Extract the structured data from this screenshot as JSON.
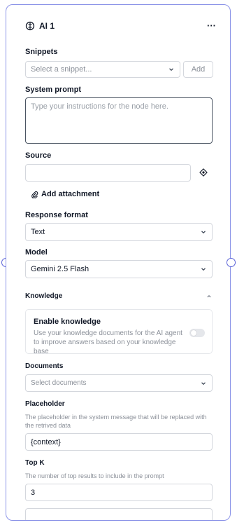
{
  "node": {
    "title": "AI 1",
    "more_label": "···",
    "border_color": "#8b93e8"
  },
  "snippets": {
    "label": "Snippets",
    "placeholder": "Select a snippet...",
    "add_label": "Add"
  },
  "system_prompt": {
    "label": "System prompt",
    "placeholder": "Type your instructions for the node here."
  },
  "source": {
    "label": "Source",
    "value": "",
    "icon": "variable-diamond-icon"
  },
  "attachment": {
    "label": "Add attachment",
    "icon": "paperclip-icon"
  },
  "response_format": {
    "label": "Response format",
    "value": "Text"
  },
  "model": {
    "label": "Model",
    "value": "Gemini 2.5 Flash"
  },
  "knowledge": {
    "section_title": "Knowledge",
    "enable_title": "Enable knowledge",
    "enable_desc": "Use your knowledge documents for the AI agent to improve answers based on your knowledge base",
    "enabled": false
  },
  "documents": {
    "label": "Documents",
    "placeholder": "Select documents"
  },
  "placeholder_field": {
    "label": "Placeholder",
    "help": "The placeholder in the system message that will be replaced with the retrived data",
    "value": "{context}"
  },
  "top_k": {
    "label": "Top K",
    "help": "The number of top results to include in the prompt",
    "value": "3"
  }
}
